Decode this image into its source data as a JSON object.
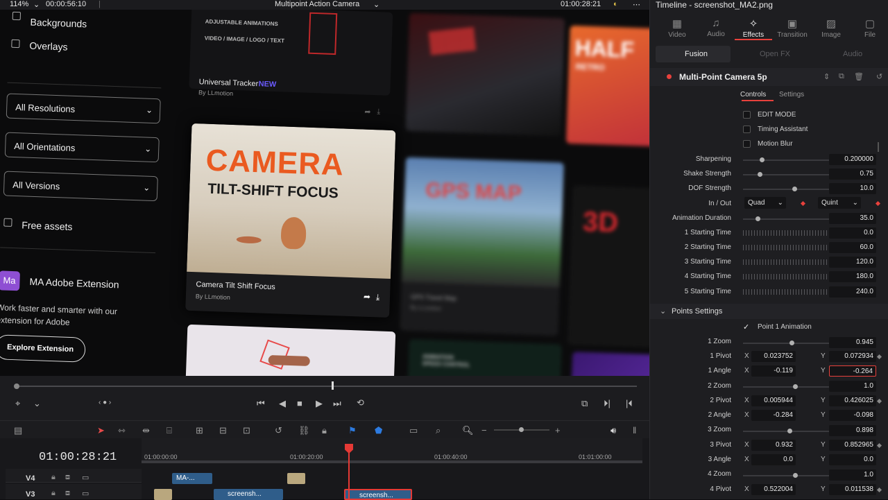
{
  "topbar": {
    "zoom": "114%",
    "timecode_left": "00:00:56:10",
    "project_title": "Multipoint Action Camera",
    "timecode_right": "01:00:28:21"
  },
  "website": {
    "filters": {
      "backgrounds": "Backgrounds",
      "overlays": "Overlays",
      "resolutions": "All Resolutions",
      "orientations": "All Orientations",
      "versions": "All Versions",
      "free_assets": "Free assets"
    },
    "promo": {
      "logo": "Ma",
      "title": "MA Adobe Extension",
      "description_line1": "Work faster and smarter with our",
      "description_line2": "extension for Adobe",
      "button": "Explore Extension"
    },
    "cards": {
      "tracker_banner1": "ADJUSTABLE ANIMATIONS",
      "tracker_banner2": "VIDEO / IMAGE / LOGO / TEXT",
      "tracker_title": "Universal Tracker",
      "tracker_badge": "NEW",
      "tracker_author": "By LLmotion",
      "camera_line1": "CAMERA",
      "camera_line2": "TILT-SHIFT FOCUS",
      "camera_title": "Camera Tilt Shift Focus",
      "camera_author": "By LLmotion",
      "gps_text": "GPS MAP",
      "gps_title": "GPS Travel Map",
      "gps_author": "By LLmotion",
      "half_text": "HALF",
      "half_sub": "RETRO",
      "threed_text": "3D",
      "speed_text1": "ANIMATION",
      "speed_text2": "SPEED CONTROL"
    }
  },
  "timeline": {
    "timecode": "01:00:28:21",
    "ruler": [
      "01:00:00:00",
      "01:00:20:00",
      "01:00:40:00",
      "01:01:00:00"
    ],
    "tracks": [
      {
        "name": "V4",
        "clips": [
          {
            "label": "MA-..."
          }
        ]
      },
      {
        "name": "V3",
        "clips": [
          {
            "label": "screensh..."
          },
          {
            "label": "screensh..."
          }
        ]
      }
    ]
  },
  "inspector": {
    "title": "Timeline - screenshot_MA2.png",
    "tabs": [
      "Video",
      "Audio",
      "Effects",
      "Transition",
      "Image",
      "File"
    ],
    "active_tab": "Effects",
    "subtabs": [
      "Fusion",
      "Open FX",
      "Audio"
    ],
    "effect_name": "Multi-Point Camera 5p",
    "control_tabs": [
      "Controls",
      "Settings"
    ],
    "checkboxes": [
      "EDIT MODE",
      "Timing Assistant",
      "Motion Blur"
    ],
    "params": [
      {
        "label": "Sharpening",
        "value": "0.200000",
        "level": 0.2
      },
      {
        "label": "Shake Strength",
        "value": "0.75",
        "level": 0.18
      },
      {
        "label": "DOF Strength",
        "value": "10.0",
        "level": 0.6
      }
    ],
    "inout": {
      "label": "In / Out",
      "in": "Quad",
      "out": "Quint"
    },
    "anim_duration": {
      "label": "Animation Duration",
      "value": "35.0",
      "level": 0.15
    },
    "starting_times": [
      {
        "label": "1 Starting Time",
        "value": "0.0"
      },
      {
        "label": "2 Starting Time",
        "value": "60.0"
      },
      {
        "label": "3 Starting Time",
        "value": "120.0"
      },
      {
        "label": "4 Starting Time",
        "value": "180.0"
      },
      {
        "label": "5 Starting Time",
        "value": "240.0"
      }
    ],
    "points_section": "Points Settings",
    "point1_anim": "Point 1 Animation",
    "points": {
      "zoom1": "0.945",
      "pivot1_x": "0.023752",
      "pivot1_y": "0.072934",
      "angle1_x": "-0.119",
      "angle1_y": "-0.264",
      "zoom2": "1.0",
      "pivot2_x": "0.005944",
      "pivot2_y": "0.426025",
      "angle2_x": "-0.284",
      "angle2_y": "-0.098",
      "zoom3": "0.898",
      "pivot3_x": "0.932",
      "pivot3_y": "0.852965",
      "angle3_x": "0.0",
      "angle3_y": "0.0",
      "zoom4": "1.0",
      "pivot4_x": "0.522004",
      "pivot4_y": "0.011538"
    },
    "point_labels": {
      "zoom1": "1 Zoom",
      "pivot1": "1 Pivot",
      "angle1": "1 Angle",
      "zoom2": "2 Zoom",
      "pivot2": "2 Pivot",
      "angle2": "2 Angle",
      "zoom3": "3 Zoom",
      "pivot3": "3 Pivot",
      "angle3": "3 Angle",
      "zoom4": "4 Zoom",
      "pivot4": "4 Pivot",
      "x": "X",
      "y": "Y"
    }
  },
  "colors": {
    "accent_red": "#e8413c",
    "playhead": "#e53935",
    "clip_blue": "#2f5d8a",
    "clip_tan": "#b9a77e"
  }
}
